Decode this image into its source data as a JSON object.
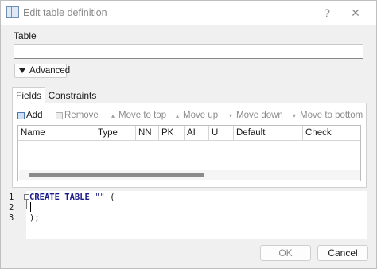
{
  "window": {
    "title": "Edit table definition",
    "help_glyph": "?",
    "close_glyph": "✕"
  },
  "table": {
    "label": "Table",
    "name_value": ""
  },
  "advanced": {
    "label": "Advanced"
  },
  "tabs": [
    {
      "label": "Fields",
      "active": true
    },
    {
      "label": "Constraints",
      "active": false
    }
  ],
  "toolbar": {
    "add": "Add",
    "remove": "Remove",
    "move_top": "Move to top",
    "move_up": "Move up",
    "move_down": "Move down",
    "move_bottom": "Move to bottom"
  },
  "fields_grid": {
    "columns": [
      "Name",
      "Type",
      "NN",
      "PK",
      "AI",
      "U",
      "Default",
      "Check"
    ],
    "rows": []
  },
  "sql_editor": {
    "line_numbers": [
      "1",
      "2",
      "3"
    ],
    "line1_keyword": "CREATE TABLE",
    "line1_string": "\"\"",
    "line1_rest": " (",
    "line3": ");"
  },
  "buttons": {
    "ok": "OK",
    "cancel": "Cancel"
  },
  "colors": {
    "sql_keyword": "#1a1a8c",
    "disabled_text": "#8c8c8c",
    "window_bg": "#f0f0f0"
  }
}
